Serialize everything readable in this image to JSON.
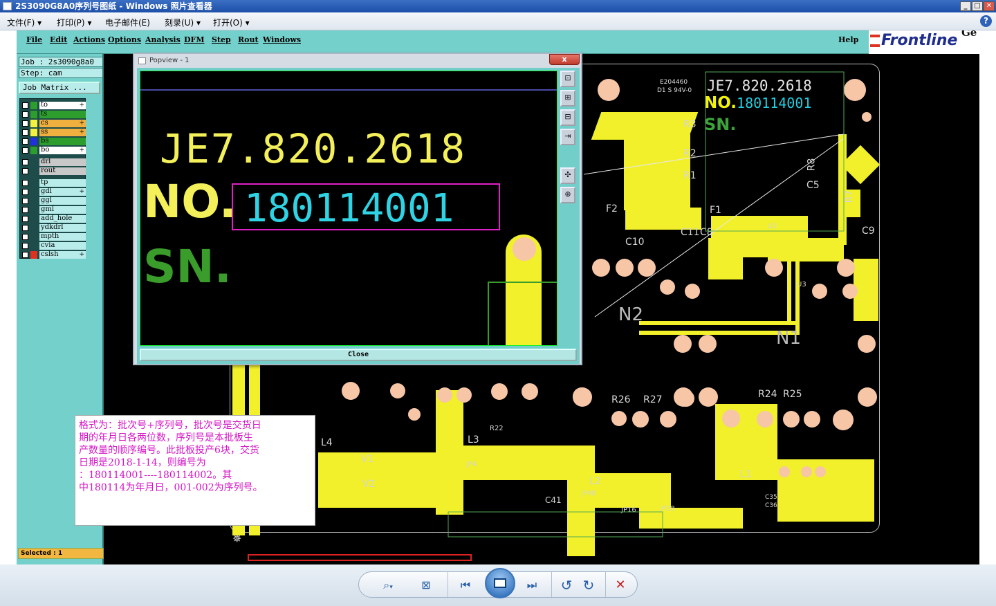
{
  "window": {
    "title": "2S3090G8A0序列号图纸 - Windows 照片查看器",
    "controls": [
      "_",
      "□",
      "✕"
    ]
  },
  "viewer_menu": [
    {
      "label": "文件(F)",
      "arrow": "▾"
    },
    {
      "label": "打印(P)",
      "arrow": "▾"
    },
    {
      "label": "电子邮件(E)",
      "arrow": ""
    },
    {
      "label": "刻录(U)",
      "arrow": "▾"
    },
    {
      "label": "打开(O)",
      "arrow": "▾"
    }
  ],
  "help_icon": "?",
  "frontline": {
    "menu": [
      "File",
      "Edit",
      "Actions",
      "Options",
      "Analysis",
      "DFM",
      "Step",
      "Rout",
      "Windows"
    ],
    "help": "Help",
    "logo": "Frontline",
    "logo_suffix": "Ge",
    "job": "Job : 2s3090g8a0",
    "step": "Step: cam",
    "job_matrix": "Job Matrix ...",
    "layers": [
      {
        "name": "to",
        "color": "#2d9e2d",
        "bg": "#ffffff",
        "mark": "+"
      },
      {
        "name": "ts",
        "color": "#2d9e2d",
        "bg": "#2d9e2d",
        "mark": ""
      },
      {
        "name": "cs",
        "color": "#f4f040",
        "bg": "#f0b040",
        "mark": "+"
      },
      {
        "name": "ss",
        "color": "#f4f040",
        "bg": "#f0b040",
        "mark": "+"
      },
      {
        "name": "bs",
        "color": "#2030e0",
        "bg": "#2d9e2d",
        "mark": ""
      },
      {
        "name": "bo",
        "color": "#2d9e2d",
        "bg": "#ffffff",
        "mark": "+"
      },
      {
        "name": "drl",
        "color": "",
        "bg": "#c8c8c8",
        "mark": ""
      },
      {
        "name": "rout",
        "color": "",
        "bg": "#c8c8c8",
        "mark": ""
      },
      {
        "name": "tp",
        "color": "",
        "bg": "#b8ecea",
        "mark": ""
      },
      {
        "name": "gdl",
        "color": "",
        "bg": "#b8ecea",
        "mark": "+"
      },
      {
        "name": "ggl",
        "color": "",
        "bg": "#b8ecea",
        "mark": ""
      },
      {
        "name": "gml",
        "color": "",
        "bg": "#b8ecea",
        "mark": ""
      },
      {
        "name": "add_hole",
        "color": "",
        "bg": "#b8ecea",
        "mark": ""
      },
      {
        "name": "ydkdrl",
        "color": "",
        "bg": "#b8ecea",
        "mark": ""
      },
      {
        "name": "mpth",
        "color": "",
        "bg": "#b8ecea",
        "mark": ""
      },
      {
        "name": "cvia",
        "color": "",
        "bg": "#b8ecea",
        "mark": ""
      },
      {
        "name": "cslsh",
        "color": "#e03020",
        "bg": "#b8ecea",
        "mark": "+"
      }
    ],
    "selected": "Selected : 1"
  },
  "pcb": {
    "part_title": "JE7.820.2618",
    "no_label": "NO.",
    "serial": "180114001",
    "sn_label": "SN.",
    "ul_mark": "E204460",
    "ul_mark2": "D1 S 94V-0",
    "silkscreen": [
      "R3",
      "R2",
      "R1",
      "R8",
      "R7",
      "C5",
      "F2",
      "F1",
      "C11",
      "C8",
      "C9",
      "C10",
      "N2",
      "N1",
      "R26",
      "R27",
      "R24",
      "R25",
      "L4",
      "L3",
      "L2",
      "L1",
      "V1",
      "V2",
      "JP4",
      "JP48",
      "JP16",
      "JP28",
      "C41",
      "C35",
      "C36",
      "R22",
      "U2",
      "U3"
    ]
  },
  "popview": {
    "title": "Popview - 1",
    "close_x": "x",
    "close_button": "Close",
    "tools": [
      "⊡",
      "⊞",
      "⊟",
      "⇥",
      "✣",
      "⊕"
    ]
  },
  "annotation": {
    "lines": [
      "格式为：批次号+序列号，批次号是交货日",
      "期的年月日各两位数，序列号是本批板生",
      "产数量的顺序编号。此批板投产6块，交货",
      "日期是2018-1-14，则编号为",
      "：180114001----180114002。其",
      "中180114为年月日，001-002为序列号。"
    ]
  },
  "toolbar": {
    "zoom": "⌕",
    "fit": "⊠",
    "prev": "⏮",
    "next": "⏭",
    "rotate_ccw": "↺",
    "rotate_cw": "↻",
    "delete": "✕"
  }
}
